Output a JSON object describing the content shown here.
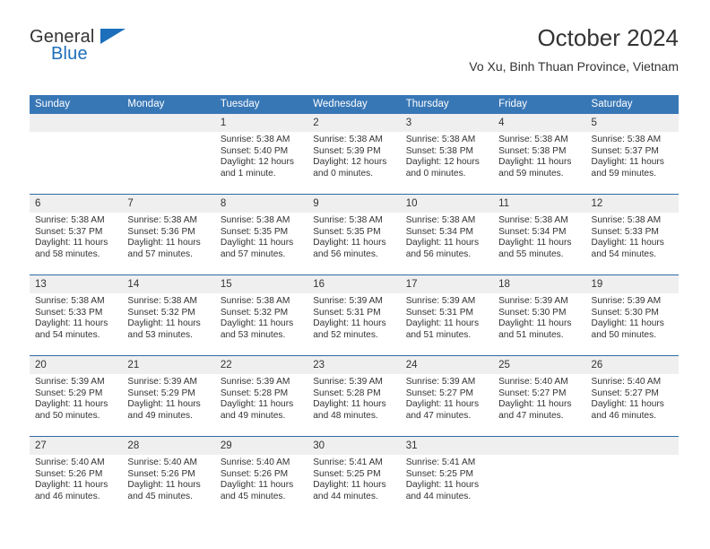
{
  "brand": {
    "name_top": "General",
    "name_bottom": "Blue",
    "accent_color": "#1c6fba",
    "logo_icon": "triangle-flag-icon"
  },
  "header": {
    "title": "October 2024",
    "subtitle": "Vo Xu, Binh Thuan Province, Vietnam"
  },
  "theme": {
    "header_row_bg": "#3877b6",
    "header_row_text": "#ffffff",
    "day_band_bg": "#efefef",
    "row_divider": "#2f6ca8",
    "body_text": "#333333"
  },
  "weekday_headers": [
    "Sunday",
    "Monday",
    "Tuesday",
    "Wednesday",
    "Thursday",
    "Friday",
    "Saturday"
  ],
  "labels": {
    "sunrise_prefix": "Sunrise:",
    "sunset_prefix": "Sunset:",
    "daylight_prefix": "Daylight:"
  },
  "weeks": [
    [
      {
        "day": "",
        "line1": "",
        "line2": "",
        "line3": "",
        "line4": ""
      },
      {
        "day": "",
        "line1": "",
        "line2": "",
        "line3": "",
        "line4": ""
      },
      {
        "day": "1",
        "line1": "Sunrise: 5:38 AM",
        "line2": "Sunset: 5:40 PM",
        "line3": "Daylight: 12 hours",
        "line4": "and 1 minute."
      },
      {
        "day": "2",
        "line1": "Sunrise: 5:38 AM",
        "line2": "Sunset: 5:39 PM",
        "line3": "Daylight: 12 hours",
        "line4": "and 0 minutes."
      },
      {
        "day": "3",
        "line1": "Sunrise: 5:38 AM",
        "line2": "Sunset: 5:38 PM",
        "line3": "Daylight: 12 hours",
        "line4": "and 0 minutes."
      },
      {
        "day": "4",
        "line1": "Sunrise: 5:38 AM",
        "line2": "Sunset: 5:38 PM",
        "line3": "Daylight: 11 hours",
        "line4": "and 59 minutes."
      },
      {
        "day": "5",
        "line1": "Sunrise: 5:38 AM",
        "line2": "Sunset: 5:37 PM",
        "line3": "Daylight: 11 hours",
        "line4": "and 59 minutes."
      }
    ],
    [
      {
        "day": "6",
        "line1": "Sunrise: 5:38 AM",
        "line2": "Sunset: 5:37 PM",
        "line3": "Daylight: 11 hours",
        "line4": "and 58 minutes."
      },
      {
        "day": "7",
        "line1": "Sunrise: 5:38 AM",
        "line2": "Sunset: 5:36 PM",
        "line3": "Daylight: 11 hours",
        "line4": "and 57 minutes."
      },
      {
        "day": "8",
        "line1": "Sunrise: 5:38 AM",
        "line2": "Sunset: 5:35 PM",
        "line3": "Daylight: 11 hours",
        "line4": "and 57 minutes."
      },
      {
        "day": "9",
        "line1": "Sunrise: 5:38 AM",
        "line2": "Sunset: 5:35 PM",
        "line3": "Daylight: 11 hours",
        "line4": "and 56 minutes."
      },
      {
        "day": "10",
        "line1": "Sunrise: 5:38 AM",
        "line2": "Sunset: 5:34 PM",
        "line3": "Daylight: 11 hours",
        "line4": "and 56 minutes."
      },
      {
        "day": "11",
        "line1": "Sunrise: 5:38 AM",
        "line2": "Sunset: 5:34 PM",
        "line3": "Daylight: 11 hours",
        "line4": "and 55 minutes."
      },
      {
        "day": "12",
        "line1": "Sunrise: 5:38 AM",
        "line2": "Sunset: 5:33 PM",
        "line3": "Daylight: 11 hours",
        "line4": "and 54 minutes."
      }
    ],
    [
      {
        "day": "13",
        "line1": "Sunrise: 5:38 AM",
        "line2": "Sunset: 5:33 PM",
        "line3": "Daylight: 11 hours",
        "line4": "and 54 minutes."
      },
      {
        "day": "14",
        "line1": "Sunrise: 5:38 AM",
        "line2": "Sunset: 5:32 PM",
        "line3": "Daylight: 11 hours",
        "line4": "and 53 minutes."
      },
      {
        "day": "15",
        "line1": "Sunrise: 5:38 AM",
        "line2": "Sunset: 5:32 PM",
        "line3": "Daylight: 11 hours",
        "line4": "and 53 minutes."
      },
      {
        "day": "16",
        "line1": "Sunrise: 5:39 AM",
        "line2": "Sunset: 5:31 PM",
        "line3": "Daylight: 11 hours",
        "line4": "and 52 minutes."
      },
      {
        "day": "17",
        "line1": "Sunrise: 5:39 AM",
        "line2": "Sunset: 5:31 PM",
        "line3": "Daylight: 11 hours",
        "line4": "and 51 minutes."
      },
      {
        "day": "18",
        "line1": "Sunrise: 5:39 AM",
        "line2": "Sunset: 5:30 PM",
        "line3": "Daylight: 11 hours",
        "line4": "and 51 minutes."
      },
      {
        "day": "19",
        "line1": "Sunrise: 5:39 AM",
        "line2": "Sunset: 5:30 PM",
        "line3": "Daylight: 11 hours",
        "line4": "and 50 minutes."
      }
    ],
    [
      {
        "day": "20",
        "line1": "Sunrise: 5:39 AM",
        "line2": "Sunset: 5:29 PM",
        "line3": "Daylight: 11 hours",
        "line4": "and 50 minutes."
      },
      {
        "day": "21",
        "line1": "Sunrise: 5:39 AM",
        "line2": "Sunset: 5:29 PM",
        "line3": "Daylight: 11 hours",
        "line4": "and 49 minutes."
      },
      {
        "day": "22",
        "line1": "Sunrise: 5:39 AM",
        "line2": "Sunset: 5:28 PM",
        "line3": "Daylight: 11 hours",
        "line4": "and 49 minutes."
      },
      {
        "day": "23",
        "line1": "Sunrise: 5:39 AM",
        "line2": "Sunset: 5:28 PM",
        "line3": "Daylight: 11 hours",
        "line4": "and 48 minutes."
      },
      {
        "day": "24",
        "line1": "Sunrise: 5:39 AM",
        "line2": "Sunset: 5:27 PM",
        "line3": "Daylight: 11 hours",
        "line4": "and 47 minutes."
      },
      {
        "day": "25",
        "line1": "Sunrise: 5:40 AM",
        "line2": "Sunset: 5:27 PM",
        "line3": "Daylight: 11 hours",
        "line4": "and 47 minutes."
      },
      {
        "day": "26",
        "line1": "Sunrise: 5:40 AM",
        "line2": "Sunset: 5:27 PM",
        "line3": "Daylight: 11 hours",
        "line4": "and 46 minutes."
      }
    ],
    [
      {
        "day": "27",
        "line1": "Sunrise: 5:40 AM",
        "line2": "Sunset: 5:26 PM",
        "line3": "Daylight: 11 hours",
        "line4": "and 46 minutes."
      },
      {
        "day": "28",
        "line1": "Sunrise: 5:40 AM",
        "line2": "Sunset: 5:26 PM",
        "line3": "Daylight: 11 hours",
        "line4": "and 45 minutes."
      },
      {
        "day": "29",
        "line1": "Sunrise: 5:40 AM",
        "line2": "Sunset: 5:26 PM",
        "line3": "Daylight: 11 hours",
        "line4": "and 45 minutes."
      },
      {
        "day": "30",
        "line1": "Sunrise: 5:41 AM",
        "line2": "Sunset: 5:25 PM",
        "line3": "Daylight: 11 hours",
        "line4": "and 44 minutes."
      },
      {
        "day": "31",
        "line1": "Sunrise: 5:41 AM",
        "line2": "Sunset: 5:25 PM",
        "line3": "Daylight: 11 hours",
        "line4": "and 44 minutes."
      },
      {
        "day": "",
        "line1": "",
        "line2": "",
        "line3": "",
        "line4": ""
      },
      {
        "day": "",
        "line1": "",
        "line2": "",
        "line3": "",
        "line4": ""
      }
    ]
  ]
}
